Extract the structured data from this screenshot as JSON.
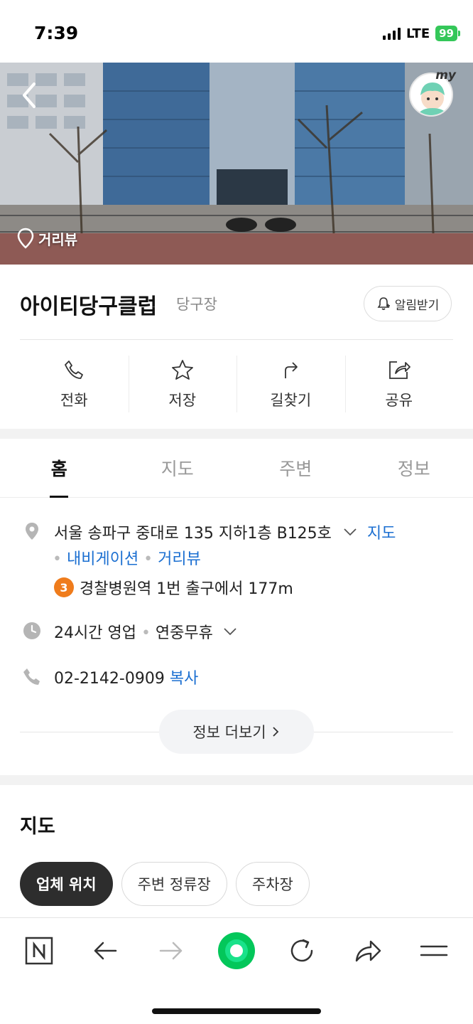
{
  "status_bar": {
    "time": "7:39",
    "network": "LTE",
    "battery": "99"
  },
  "hero": {
    "streetview_label": "거리뷰",
    "my_label": "my"
  },
  "place": {
    "name": "아이티당구클럽",
    "category": "당구장",
    "alarm_label": "알림받기"
  },
  "actions": [
    {
      "label": "전화",
      "icon": "phone-icon"
    },
    {
      "label": "저장",
      "icon": "star-icon"
    },
    {
      "label": "길찾기",
      "icon": "directions-icon"
    },
    {
      "label": "공유",
      "icon": "share-icon"
    }
  ],
  "tabs": [
    {
      "label": "홈",
      "active": true
    },
    {
      "label": "지도",
      "active": false
    },
    {
      "label": "주변",
      "active": false
    },
    {
      "label": "정보",
      "active": false
    }
  ],
  "address": {
    "text": "서울 송파구 중대로 135 지하1층 B125호",
    "map_link": "지도",
    "navigation_link": "내비게이션",
    "streetview_link": "거리뷰"
  },
  "subway": {
    "line": "3",
    "line_color": "#ef7c1c",
    "text": "경찰병원역 1번 출구에서 177m"
  },
  "hours": {
    "status": "24시간 영업",
    "holiday": "연중무휴"
  },
  "phone": {
    "number": "02-2142-0909",
    "copy_label": "복사"
  },
  "more_info_label": "정보 더보기",
  "map_section": {
    "title": "지도",
    "chips": [
      {
        "label": "업체 위치",
        "active": true
      },
      {
        "label": "주변 정류장",
        "active": false
      },
      {
        "label": "주차장",
        "active": false
      }
    ]
  },
  "toolbar": {
    "items": [
      "naver-home-icon",
      "back-arrow-icon",
      "forward-arrow-icon",
      "green-dot-icon",
      "reload-icon",
      "share-arrow-icon",
      "menu-icon"
    ],
    "accent": "#03c75a"
  }
}
